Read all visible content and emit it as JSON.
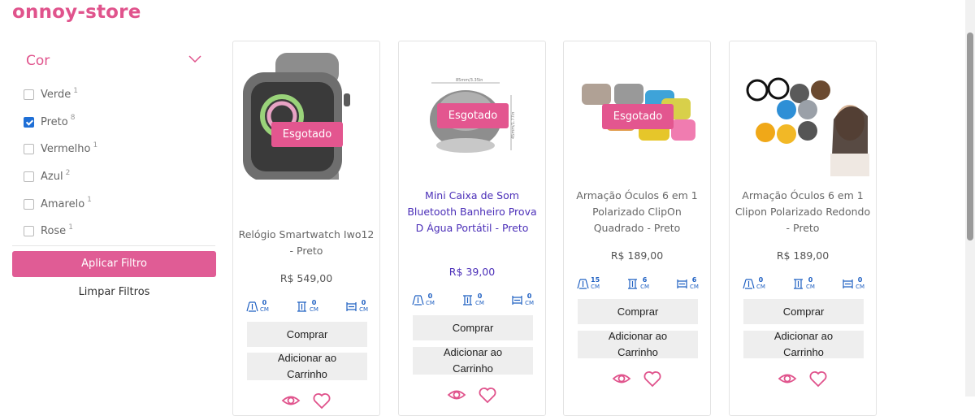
{
  "brand": "onnoy-store",
  "colors": {
    "accent": "#e0538c",
    "link": "#4b2fb8",
    "measure": "#1f60c2"
  },
  "filter": {
    "title": "Cor",
    "options": [
      {
        "label": "Verde",
        "count": "1",
        "checked": false
      },
      {
        "label": "Preto",
        "count": "8",
        "checked": true
      },
      {
        "label": "Vermelho",
        "count": "1",
        "checked": false
      },
      {
        "label": "Azul",
        "count": "2",
        "checked": false
      },
      {
        "label": "Amarelo",
        "count": "1",
        "checked": false
      },
      {
        "label": "Rose",
        "count": "1",
        "checked": false
      }
    ],
    "apply_label": "Aplicar Filtro",
    "clear_label": "Limpar Filtros"
  },
  "products": [
    {
      "name": "Relógio Smartwatch Iwo12 - Preto",
      "price": "R$ 549,00",
      "badge": "Esgotado",
      "measures": [
        {
          "n": "0",
          "u": "CM"
        },
        {
          "n": "0",
          "u": "CM"
        },
        {
          "n": "0",
          "u": "CM"
        }
      ],
      "buy_label": "Comprar",
      "cart_label": "Adicionar ao Carrinho"
    },
    {
      "name": "Mini Caixa de Som Bluetooth Banheiro Prova D Água Portátil - Preto",
      "price": "R$ 39,00",
      "badge": "Esgotado",
      "image_text": [
        "85mm/3.35in",
        "45mm/1.77in"
      ],
      "measures": [
        {
          "n": "0",
          "u": "CM"
        },
        {
          "n": "0",
          "u": "CM"
        },
        {
          "n": "0",
          "u": "CM"
        }
      ],
      "buy_label": "Comprar",
      "cart_label": "Adicionar ao Carrinho"
    },
    {
      "name": "Armação Óculos 6 em 1 Polarizado ClipOn Quadrado - Preto",
      "price": "R$ 189,00",
      "badge": "Esgotado",
      "measures": [
        {
          "n": "15",
          "u": "CM"
        },
        {
          "n": "6",
          "u": "CM"
        },
        {
          "n": "6",
          "u": "CM"
        }
      ],
      "buy_label": "Comprar",
      "cart_label": "Adicionar ao Carrinho"
    },
    {
      "name": "Armação Óculos 6 em 1 Clipon Polarizado Redondo - Preto",
      "price": "R$ 189,00",
      "measures": [
        {
          "n": "0",
          "u": "CM"
        },
        {
          "n": "0",
          "u": "CM"
        },
        {
          "n": "0",
          "u": "CM"
        }
      ],
      "buy_label": "Comprar",
      "cart_label": "Adicionar ao Carrinho"
    }
  ]
}
